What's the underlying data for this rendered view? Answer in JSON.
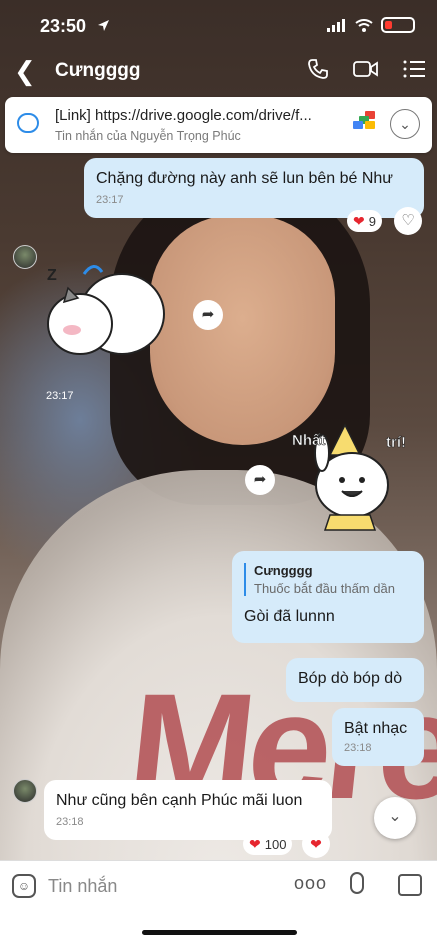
{
  "status_bar": {
    "time": "23:50",
    "icons": [
      "location-arrow-icon",
      "signal-icon",
      "wifi-icon",
      "battery-low-icon"
    ]
  },
  "header": {
    "title": "Cưngggg",
    "icons": [
      "back-icon",
      "phone-icon",
      "video-icon",
      "menu-icon"
    ]
  },
  "pinned": {
    "link_text": "[Link] https://drive.google.com/drive/f...",
    "subtitle": "Tin nhắn của Nguyễn Trọng Phúc"
  },
  "messages": [
    {
      "text": "Chặng đường này anh sẽ lun bên bé Như",
      "time": "23:17",
      "reaction_count": "9"
    },
    {
      "sticker": "sleeping-cat-sticker",
      "time": "23:17"
    },
    {
      "sticker": "bunny-party-sticker",
      "sticker_text_1": "Nhất",
      "sticker_text_2": "trí!"
    },
    {
      "quote_author": "Cưngggg",
      "quote_text": "Thuốc bắt đầu thấm dần",
      "text": "Gòi đã lunnn"
    },
    {
      "text": "Bóp dò bóp dò"
    },
    {
      "text": "Bật nhạc",
      "time": "23:18"
    },
    {
      "text": "Như cũng bên cạnh Phúc mãi luon",
      "time": "23:18",
      "reaction_count": "100"
    }
  ],
  "input": {
    "placeholder": "Tin nhắn",
    "more_label": "ooo"
  },
  "background_text": "Mere",
  "colors": {
    "accent": "#2d8ce8",
    "sent_bubble": "#d6ebfa",
    "heart": "#e6262f"
  }
}
